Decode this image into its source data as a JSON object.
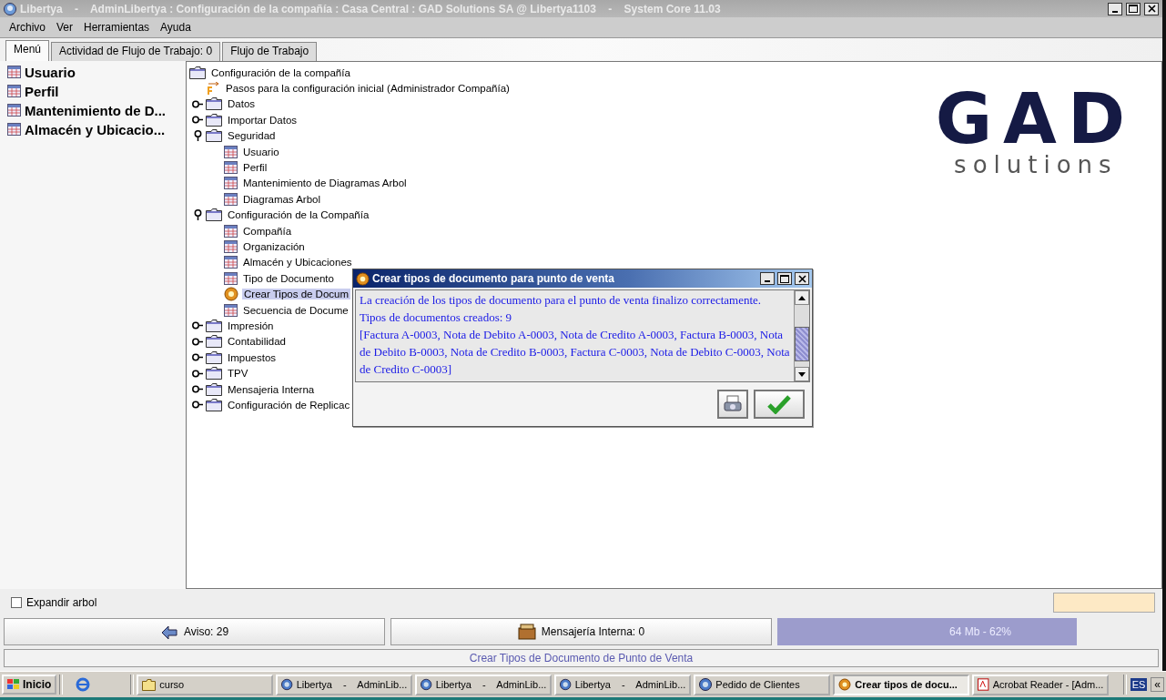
{
  "window": {
    "title": "Libertya    -    AdminLibertya : Configuración de la compañía : Casa Central : GAD Solutions SA @ Libertya1103    -    System Core 11.03"
  },
  "menu": [
    "Archivo",
    "Ver",
    "Herramientas",
    "Ayuda"
  ],
  "tabs": [
    {
      "label": "Menú",
      "selected": true
    },
    {
      "label": "Actividad de Flujo de Trabajo: 0",
      "selected": false
    },
    {
      "label": "Flujo de Trabajo",
      "selected": false
    }
  ],
  "favorites": [
    "Usuario",
    "Perfil",
    "Mantenimiento de D...",
    "Almacén y Ubicacio..."
  ],
  "tree": {
    "label": "Configuración de la compañía",
    "kind": "folder",
    "selected": false,
    "children": [
      {
        "label": "Pasos para la configuración inicial (Administrador Compañía)",
        "kind": "workflow",
        "selected": false
      },
      {
        "label": "Datos",
        "kind": "folder",
        "expanded": false,
        "selected": false
      },
      {
        "label": "Importar Datos",
        "kind": "folder",
        "expanded": false,
        "selected": false
      },
      {
        "label": "Seguridad",
        "kind": "folder",
        "expanded": true,
        "selected": false,
        "children": [
          {
            "label": "Usuario",
            "kind": "window",
            "selected": false
          },
          {
            "label": "Perfil",
            "kind": "window",
            "selected": false
          },
          {
            "label": "Mantenimiento de Diagramas Arbol",
            "kind": "window",
            "selected": false
          },
          {
            "label": "Diagramas Arbol",
            "kind": "window",
            "selected": false
          }
        ]
      },
      {
        "label": "Configuración de la Compañía",
        "kind": "folder",
        "expanded": true,
        "selected": false,
        "children": [
          {
            "label": "Compañía",
            "kind": "window",
            "selected": false
          },
          {
            "label": "Organización",
            "kind": "window",
            "selected": false
          },
          {
            "label": "Almacén y Ubicaciones",
            "kind": "window",
            "selected": false
          },
          {
            "label": "Tipo de Documento",
            "kind": "window",
            "selected": false
          },
          {
            "label": "Crear Tipos de Docum",
            "kind": "process",
            "selected": true
          },
          {
            "label": "Secuencia de Docume",
            "kind": "window",
            "selected": false
          }
        ]
      },
      {
        "label": "Impresión",
        "kind": "folder",
        "expanded": false,
        "selected": false
      },
      {
        "label": "Contabilidad",
        "kind": "folder",
        "expanded": false,
        "selected": false
      },
      {
        "label": "Impuestos",
        "kind": "folder",
        "expanded": false,
        "selected": false
      },
      {
        "label": "TPV",
        "kind": "folder",
        "expanded": false,
        "selected": false
      },
      {
        "label": "Mensajeria Interna",
        "kind": "folder",
        "expanded": false,
        "selected": false
      },
      {
        "label": "Configuración de Replicac",
        "kind": "folder",
        "expanded": false,
        "selected": false
      }
    ]
  },
  "logo": {
    "name": "GAD",
    "tagline": "solutions"
  },
  "dialog": {
    "title": "Crear tipos de documento para punto de venta",
    "lines": [
      "La creación de los tipos de documento para el punto de venta finalizo correctamente.",
      "Tipos de documentos creados: 9",
      "[Factura A-0003, Nota de Debito A-0003, Nota de Credito A-0003, Factura B-0003, Nota de Debito B-0003, Nota de Credito B-0003, Factura C-0003, Nota de Debito C-0003, Nota de Credito C-0003]"
    ]
  },
  "expand_tree": {
    "label": "Expandir arbol",
    "checked": false
  },
  "status_buttons": [
    {
      "kind": "notice",
      "label": "Aviso: 29"
    },
    {
      "kind": "mail",
      "label": "Mensajería Interna: 0"
    }
  ],
  "memory": "64 Mb - 62%",
  "status_line": "Crear Tipos de Documento de Punto de Venta",
  "taskbar": {
    "start": "Inicio",
    "items": [
      {
        "kind": "folder",
        "label": "curso",
        "selected": false
      },
      {
        "kind": "app",
        "label": "Libertya    -    AdminLib...",
        "selected": false
      },
      {
        "kind": "app",
        "label": "Libertya    -    AdminLib...",
        "selected": false
      },
      {
        "kind": "app",
        "label": "Libertya    -    AdminLib...",
        "selected": false
      },
      {
        "kind": "app",
        "label": "Pedido de Clientes",
        "selected": false
      },
      {
        "kind": "process",
        "label": "Crear tipos de docu...",
        "selected": true
      },
      {
        "kind": "pdf",
        "label": "Acrobat Reader - [Adm...",
        "selected": false
      }
    ],
    "language": "ES",
    "collapse": "«"
  }
}
